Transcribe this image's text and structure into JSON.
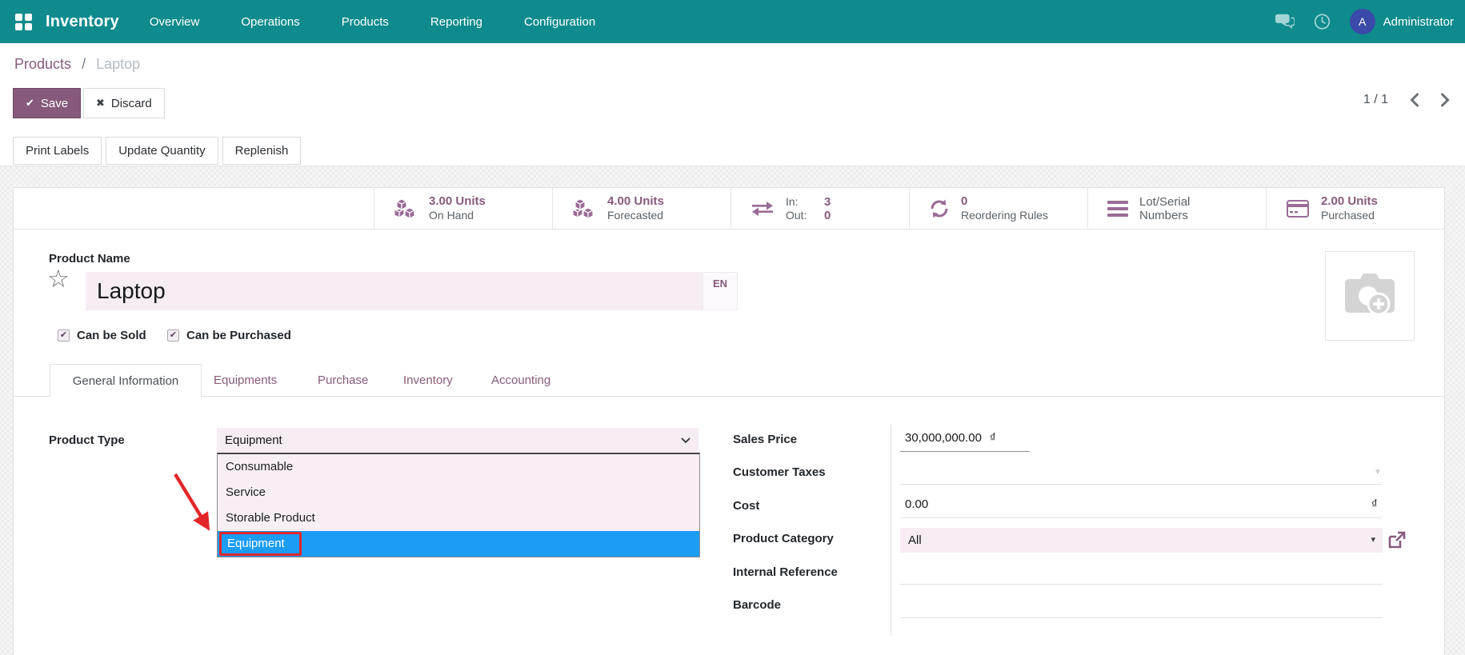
{
  "colors": {
    "navbar_bg": "#0f8b8d",
    "brand_purple": "#875a7b",
    "highlight_blue": "#1b9cf5",
    "annotation_red": "#e3262a",
    "field_lavender": "#f6ecf4"
  },
  "icons": {
    "check": "✔",
    "close": "✖",
    "star": "☆",
    "caret_down": "▾",
    "caret_down_light": "▼"
  },
  "navbar": {
    "app_name": "Inventory",
    "items": [
      "Overview",
      "Operations",
      "Products",
      "Reporting",
      "Configuration"
    ],
    "user": "Administrator",
    "avatar_initial": "A"
  },
  "breadcrumb": {
    "parent": "Products",
    "separator": "/",
    "current": "Laptop"
  },
  "control_panel": {
    "save": "Save",
    "discard": "Discard",
    "pager": "1 / 1"
  },
  "action_buttons": [
    "Print Labels",
    "Update Quantity",
    "Replenish"
  ],
  "stat_buttons": {
    "on_hand": {
      "value": "3.00 Units",
      "label": "On Hand"
    },
    "forecasted": {
      "value": "4.00 Units",
      "label": "Forecasted"
    },
    "in_out": {
      "in_label": "In:",
      "in_value": "3",
      "out_label": "Out:",
      "out_value": "0"
    },
    "reordering": {
      "value": "0",
      "label": "Reordering Rules"
    },
    "lot_serial": {
      "line1": "Lot/Serial",
      "line2": "Numbers"
    },
    "purchased": {
      "value": "2.00 Units",
      "label": "Purchased"
    }
  },
  "product": {
    "name_label": "Product Name",
    "name": "Laptop",
    "lang_badge": "EN",
    "can_be_sold": "Can be Sold",
    "can_be_purchased": "Can be Purchased"
  },
  "tabs": {
    "active": "General Information",
    "others": [
      "Equipments",
      "Purchase",
      "Inventory",
      "Accounting"
    ]
  },
  "form": {
    "product_type": {
      "label": "Product Type",
      "selected": "Equipment",
      "options": [
        "Consumable",
        "Service",
        "Storable Product",
        "Equipment"
      ],
      "highlighted_option": "Equipment"
    },
    "sales_price": {
      "label": "Sales Price",
      "value": "30,000,000.00",
      "currency": "₫"
    },
    "customer_taxes": {
      "label": "Customer Taxes",
      "value": ""
    },
    "cost": {
      "label": "Cost",
      "value": "0.00",
      "currency": "₫"
    },
    "product_category": {
      "label": "Product Category",
      "value": "All"
    },
    "internal_reference": {
      "label": "Internal Reference",
      "value": ""
    },
    "barcode": {
      "label": "Barcode",
      "value": ""
    }
  }
}
